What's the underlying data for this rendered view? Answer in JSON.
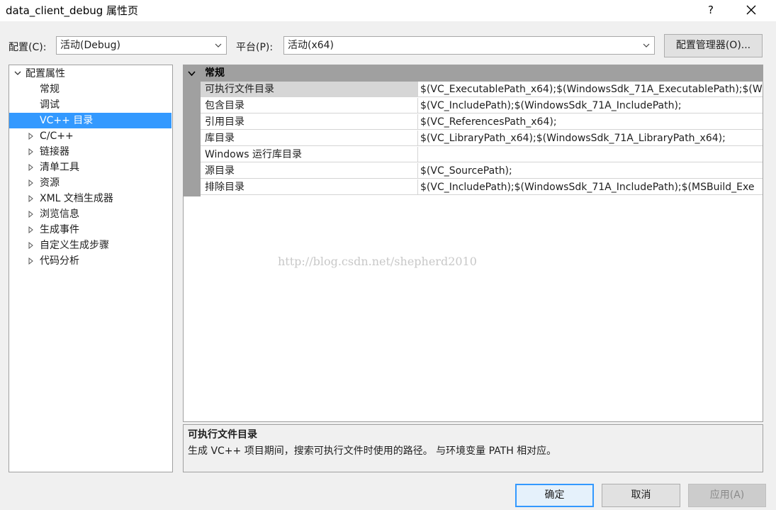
{
  "window": {
    "title": "data_client_debug 属性页",
    "help": "?"
  },
  "toolbar": {
    "config_label": "配置(C):",
    "config_value": "活动(Debug)",
    "platform_label": "平台(P):",
    "platform_value": "活动(x64)",
    "manager_button": "配置管理器(O)..."
  },
  "tree": {
    "root": "配置属性",
    "items": [
      {
        "label": "常规",
        "expandable": false
      },
      {
        "label": "调试",
        "expandable": false
      },
      {
        "label": "VC++ 目录",
        "expandable": false,
        "selected": true
      },
      {
        "label": "C/C++",
        "expandable": true
      },
      {
        "label": "链接器",
        "expandable": true
      },
      {
        "label": "清单工具",
        "expandable": true
      },
      {
        "label": "资源",
        "expandable": true
      },
      {
        "label": "XML 文档生成器",
        "expandable": true
      },
      {
        "label": "浏览信息",
        "expandable": true
      },
      {
        "label": "生成事件",
        "expandable": true
      },
      {
        "label": "自定义生成步骤",
        "expandable": true
      },
      {
        "label": "代码分析",
        "expandable": true
      }
    ]
  },
  "grid": {
    "category": "常规",
    "rows": [
      {
        "name": "可执行文件目录",
        "value": "$(VC_ExecutablePath_x64);$(WindowsSdk_71A_ExecutablePath);$(Wi"
      },
      {
        "name": "包含目录",
        "value": "$(VC_IncludePath);$(WindowsSdk_71A_IncludePath);"
      },
      {
        "name": "引用目录",
        "value": "$(VC_ReferencesPath_x64);"
      },
      {
        "name": "库目录",
        "value": "$(VC_LibraryPath_x64);$(WindowsSdk_71A_LibraryPath_x64);"
      },
      {
        "name": "Windows 运行库目录",
        "value": ""
      },
      {
        "name": "源目录",
        "value": "$(VC_SourcePath);"
      },
      {
        "name": "排除目录",
        "value": "$(VC_IncludePath);$(WindowsSdk_71A_IncludePath);$(MSBuild_Exe"
      }
    ]
  },
  "watermark": "http://blog.csdn.net/shepherd2010",
  "description": {
    "title": "可执行文件目录",
    "text": "生成 VC++ 项目期间，搜索可执行文件时使用的路径。 与环境变量 PATH 相对应。"
  },
  "buttons": {
    "ok": "确定",
    "cancel": "取消",
    "apply": "应用(A)"
  },
  "colors": {
    "selection": "#3399ff",
    "category_bar": "#a0a0a0",
    "selected_row": "#d6d6d6"
  }
}
